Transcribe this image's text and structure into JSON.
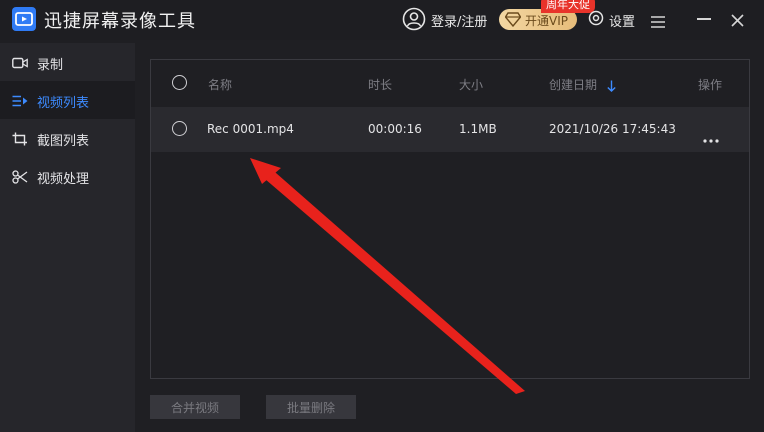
{
  "app": {
    "title": "迅捷屏幕录像工具"
  },
  "header": {
    "login_label": "登录/注册",
    "vip_label": "开通VIP",
    "promo_badge": "周年大促",
    "settings_label": "设置"
  },
  "sidebar": {
    "items": [
      {
        "label": "录制",
        "icon": "camera-icon",
        "active": false
      },
      {
        "label": "视频列表",
        "icon": "video-list-icon",
        "active": true
      },
      {
        "label": "截图列表",
        "icon": "screenshot-icon",
        "active": false
      },
      {
        "label": "视频处理",
        "icon": "video-process-icon",
        "active": false
      }
    ]
  },
  "table": {
    "columns": [
      "名称",
      "时长",
      "大小",
      "创建日期",
      "操作"
    ],
    "rows": [
      {
        "name": "Rec 0001.mp4",
        "duration": "00:00:16",
        "size": "1.1MB",
        "created": "2021/10/26 17:45:43"
      }
    ]
  },
  "actions": {
    "merge_label": "合并视频",
    "batch_delete_label": "批量删除"
  },
  "colors": {
    "accent": "#3d8bff",
    "annotation_arrow": "#e8221c",
    "promo": "#e8332a",
    "vip_gold": "#e6bc7a"
  }
}
